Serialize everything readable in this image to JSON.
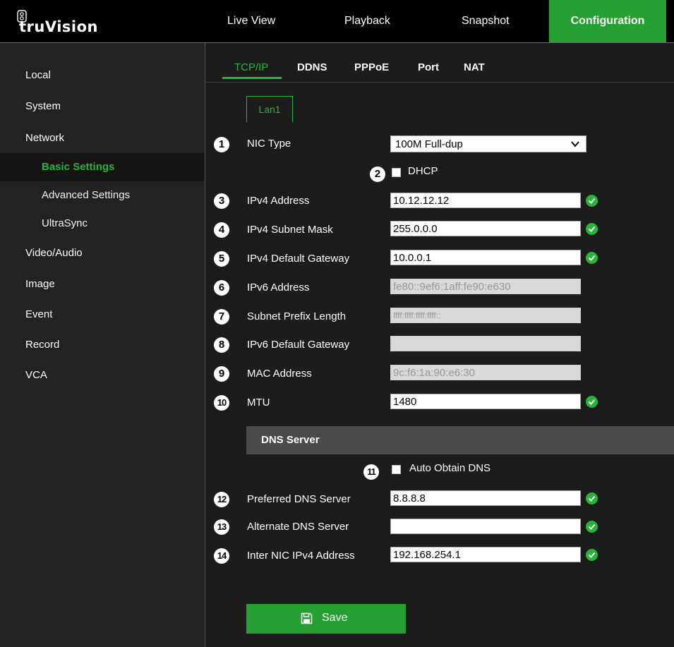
{
  "app": {
    "logo_text": "truVision"
  },
  "nav": [
    {
      "label": "Live View"
    },
    {
      "label": "Playback"
    },
    {
      "label": "Snapshot"
    },
    {
      "label": "Configuration"
    }
  ],
  "sidebar": {
    "items": [
      {
        "label": "Local"
      },
      {
        "label": "System"
      },
      {
        "label": "Network"
      },
      {
        "label": "Basic Settings"
      },
      {
        "label": "Advanced Settings"
      },
      {
        "label": "UltraSync"
      },
      {
        "label": "Video/Audio"
      },
      {
        "label": "Image"
      },
      {
        "label": "Event"
      },
      {
        "label": "Record"
      },
      {
        "label": "VCA"
      }
    ],
    "active": "Basic Settings"
  },
  "tabs": [
    {
      "label": "TCP/IP"
    },
    {
      "label": "DDNS"
    },
    {
      "label": "PPPoE"
    },
    {
      "label": "Port"
    },
    {
      "label": "NAT"
    }
  ],
  "lan_tab": "Lan1",
  "form": {
    "nic_type": {
      "num": "1",
      "label": "NIC Type",
      "value": "100M Full-dup"
    },
    "dhcp": {
      "num": "2",
      "label": "DHCP",
      "checked": false
    },
    "ipv4_address": {
      "num": "3",
      "label": "IPv4 Address",
      "value": "10.12.12.12",
      "status": "valid"
    },
    "ipv4_subnet_mask": {
      "num": "4",
      "label": "IPv4 Subnet Mask",
      "value": "255.0.0.0",
      "status": "valid"
    },
    "ipv4_default_gateway": {
      "num": "5",
      "label": "IPv4 Default Gateway",
      "value": "10.0.0.1",
      "status": "valid"
    },
    "ipv6_address": {
      "num": "6",
      "label": "IPv6 Address",
      "value": "fe80::9ef6:1aff:fe90:e630",
      "disabled": true
    },
    "subnet_prefix_length": {
      "num": "7",
      "label": "Subnet Prefix Length",
      "value": "ffff:ffff:ffff:ffff::",
      "disabled": true
    },
    "ipv6_default_gateway": {
      "num": "8",
      "label": "IPv6 Default Gateway",
      "value": "",
      "disabled": true
    },
    "mac_address": {
      "num": "9",
      "label": "MAC Address",
      "value": "9c:f6:1a:90:e6:30",
      "disabled": true
    },
    "mtu": {
      "num": "10",
      "label": "MTU",
      "value": "1480",
      "status": "valid"
    }
  },
  "dns": {
    "title": "DNS Server",
    "auto_obtain": {
      "num": "11",
      "label": "Auto Obtain DNS",
      "checked": false
    },
    "preferred": {
      "num": "12",
      "label": "Preferred DNS Server",
      "value": "8.8.8.8",
      "status": "valid"
    },
    "alternate": {
      "num": "13",
      "label": "Alternate DNS Server",
      "value": "",
      "status": "valid"
    },
    "inter_nic": {
      "num": "14",
      "label": "Inter NIC IPv4 Address",
      "value": "192.168.254.1",
      "status": "valid"
    }
  },
  "save": {
    "label": "Save",
    "icon": "floppy-disk-icon"
  },
  "colors": {
    "accent": "#28b43a",
    "button": "#26a033",
    "bar": "#000000",
    "sidebar": "#222222",
    "panel": "#1c1c1c"
  }
}
